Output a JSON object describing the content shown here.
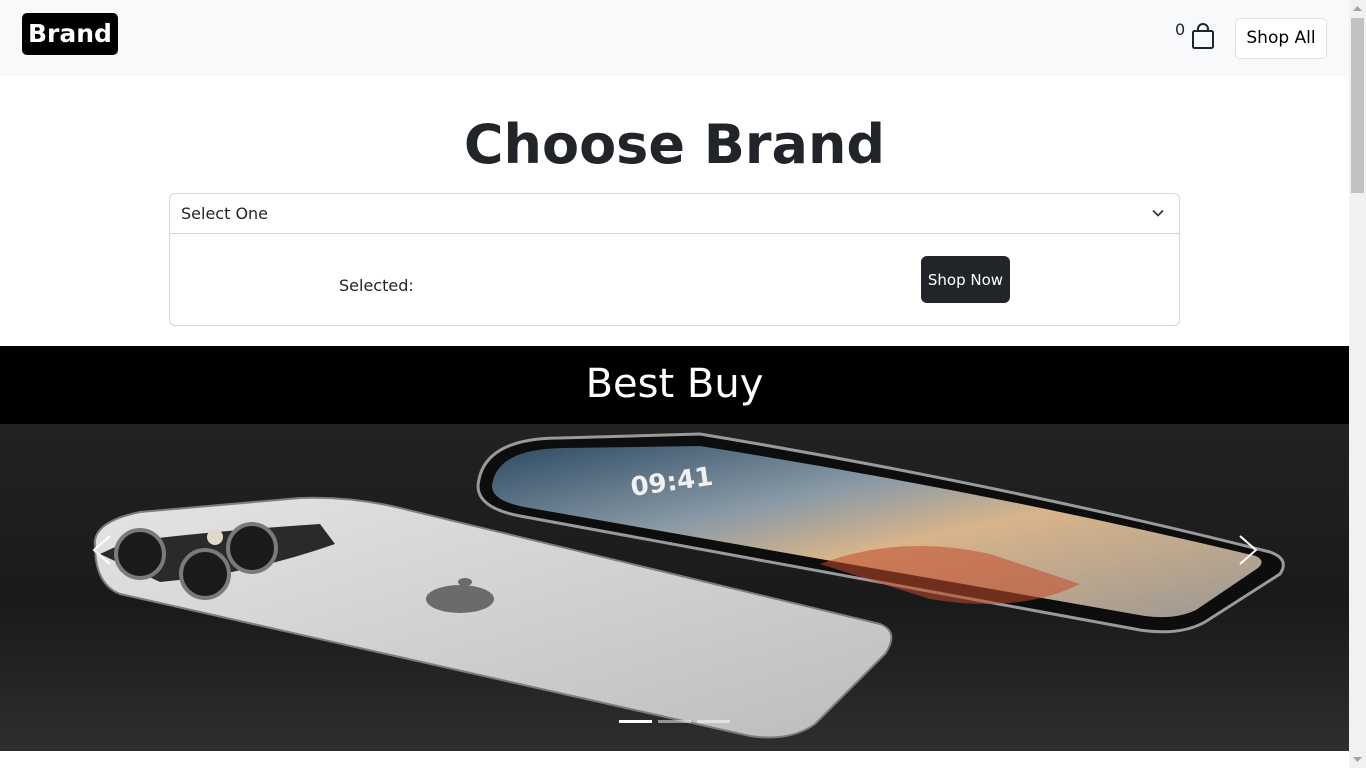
{
  "navbar": {
    "brand": "Brand",
    "cart_count": "0",
    "cart_icon": "shopping-bag-icon",
    "shop_all_label": "Shop All"
  },
  "main": {
    "title": "Choose Brand",
    "select": {
      "value": "Select One",
      "icon": "chevron-down-icon"
    },
    "selected_label": "Selected:",
    "shop_now_label": "Shop Now"
  },
  "banner": {
    "title": "Best Buy"
  },
  "carousel": {
    "image": "two-iphones-product-photo",
    "prev_icon": "chevron-left-icon",
    "next_icon": "chevron-right-icon",
    "slide_count": 3,
    "active_slide": 1
  },
  "colors": {
    "navbar_bg": "#f8f9fa",
    "dark": "#212529",
    "banner_bg": "#000000"
  }
}
